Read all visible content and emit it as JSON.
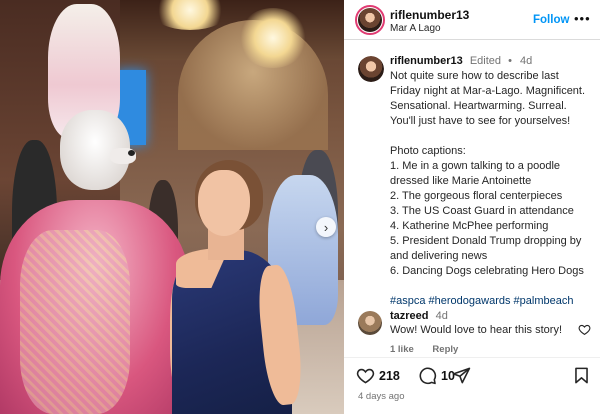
{
  "post": {
    "username": "riflenumber13",
    "location": "Mar A Lago",
    "follow_label": "Follow",
    "more_label": "•••"
  },
  "caption": {
    "username": "riflenumber13",
    "edited": "Edited",
    "dot": "•",
    "time": "4d",
    "lines": [
      "Not quite sure how to describe last",
      "Friday night at Mar-a-Lago. Magnificent.",
      "Sensational. Heartwarming. Surreal.",
      "You'll just have to see for yourselves!",
      "",
      "Photo captions:",
      "1. Me in a gown talking to a poodle",
      "dressed like Marie Antoinette",
      "2. The gorgeous floral centerpieces",
      "3. The US Coast Guard in attendance",
      "4. Katherine McPhee performing",
      "5. President Donald Trump dropping by",
      "and delivering news",
      "6. Dancing Dogs celebrating Hero Dogs",
      ""
    ],
    "hashtags": "#aspca #herodogawards #palmbeach"
  },
  "comment": {
    "username": "tazreed",
    "time": "4d",
    "text": "Wow! Would love to hear this story!",
    "likes_label": "1 like",
    "reply_label": "Reply"
  },
  "actions": {
    "likes": "218",
    "comments": "10",
    "age": "4 days ago"
  },
  "carousel": {
    "next_glyph": "›"
  },
  "icons": [
    "heart-icon",
    "comment-icon",
    "share-icon",
    "bookmark-icon",
    "chevron-right-icon",
    "more-icon"
  ],
  "colors": {
    "link": "#0095f6",
    "hashtag": "#00376b",
    "muted": "#737373",
    "story_ring": "#e03b72"
  }
}
